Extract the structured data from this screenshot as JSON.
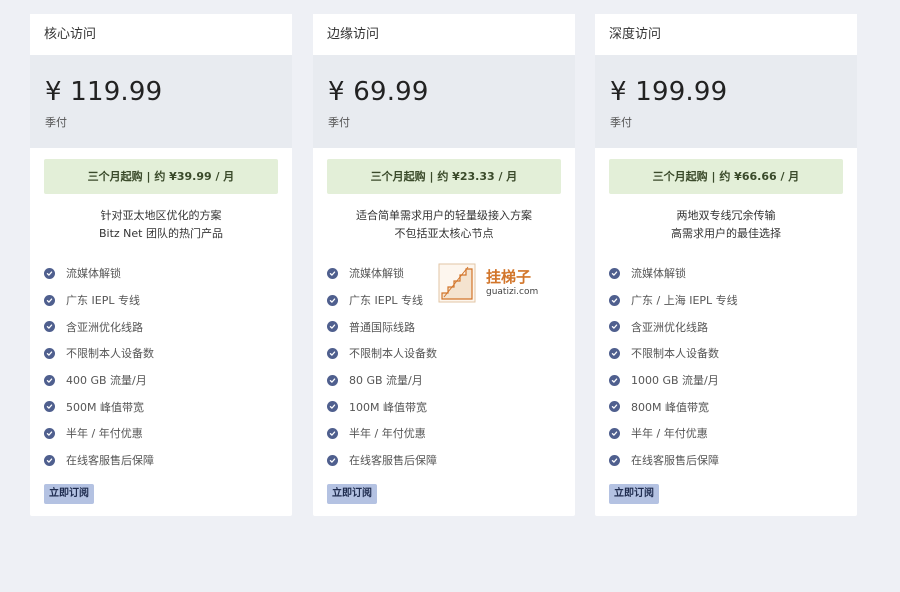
{
  "plans": [
    {
      "title": "核心访问",
      "price": "¥ 119.99",
      "period": "季付",
      "monthly": "三个月起购 | 约 ¥39.99 / 月",
      "desc": [
        "针对亚太地区优化的方案",
        "Bitz Net 团队的热门产品"
      ],
      "features": [
        "流媒体解锁",
        "广东 IEPL 专线",
        "含亚洲优化线路",
        "不限制本人设备数",
        "400 GB 流量/月",
        "500M 峰值带宽",
        "半年 / 年付优惠",
        "在线客服售后保障"
      ],
      "button": "立即订阅"
    },
    {
      "title": "边缘访问",
      "price": "¥ 69.99",
      "period": "季付",
      "monthly": "三个月起购 | 约 ¥23.33 / 月",
      "desc": [
        "适合简单需求用户的轻量级接入方案",
        "不包括亚太核心节点"
      ],
      "features": [
        "流媒体解锁",
        "广东 IEPL 专线",
        "普通国际线路",
        "不限制本人设备数",
        "80 GB 流量/月",
        "100M 峰值带宽",
        "半年 / 年付优惠",
        "在线客服售后保障"
      ],
      "button": "立即订阅"
    },
    {
      "title": "深度访问",
      "price": "¥ 199.99",
      "period": "季付",
      "monthly": "三个月起购 | 约 ¥66.66 / 月",
      "desc": [
        "两地双专线冗余传输",
        "高需求用户的最佳选择"
      ],
      "features": [
        "流媒体解锁",
        "广东 / 上海 IEPL 专线",
        "含亚洲优化线路",
        "不限制本人设备数",
        "1000 GB 流量/月",
        "800M 峰值带宽",
        "半年 / 年付优惠",
        "在线客服售后保障"
      ],
      "button": "立即订阅"
    }
  ],
  "watermark": {
    "text": "挂梯子",
    "domain": "guatizi.com"
  },
  "colors": {
    "background": "#eef0f5",
    "price_box": "#e8ebf0",
    "monthly_box": "#e3efd8",
    "check": "#4f5f8e",
    "button": "#b4c2e2",
    "watermark": "#d2752a"
  },
  "icons": {
    "feature": "check-circle-icon",
    "watermark": "stairs-icon"
  }
}
